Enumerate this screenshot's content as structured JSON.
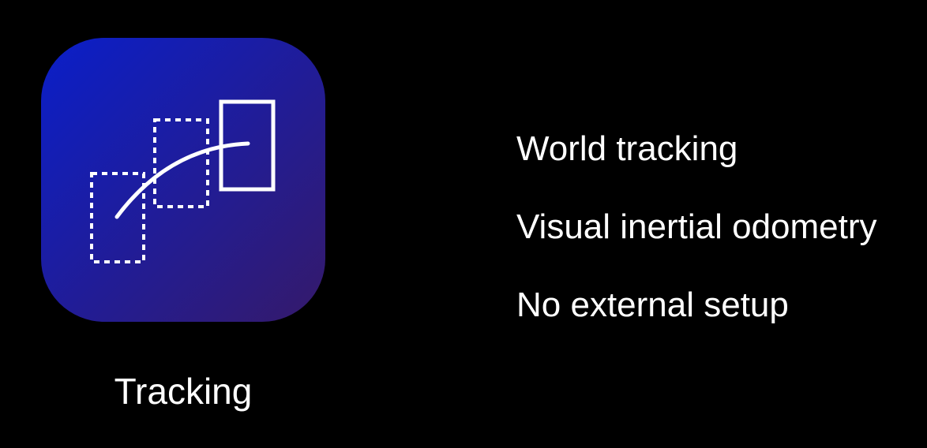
{
  "icon": {
    "name": "tracking-icon",
    "caption": "Tracking",
    "gradient_start": "#0a1fc9",
    "gradient_end": "#351a6a",
    "stroke_color": "#ffffff"
  },
  "features": [
    "World tracking",
    "Visual inertial odometry",
    "No external setup"
  ],
  "colors": {
    "background": "#000000",
    "text": "#ffffff"
  }
}
